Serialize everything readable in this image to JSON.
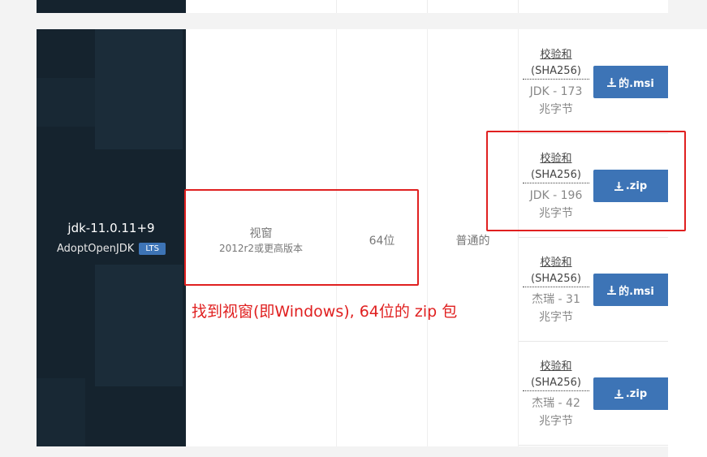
{
  "release": {
    "name": "jdk-11.0.11+9",
    "vendor": "AdoptOpenJDK",
    "badge": "LTS"
  },
  "platform": {
    "os": "视窗",
    "os_version": "2012r2或更高版本",
    "architecture": "64位",
    "jvm_type": "普通的"
  },
  "downloads": [
    {
      "checksum_line1": "校验和",
      "checksum_line2": "(SHA256)",
      "size_line1": "JDK - 173",
      "size_line2": "兆字节",
      "button_label": "的.msi",
      "icon": "download-icon"
    },
    {
      "checksum_line1": "校验和",
      "checksum_line2": "(SHA256)",
      "size_line1": "JDK - 196",
      "size_line2": "兆字节",
      "button_label": ".zip",
      "icon": "download-icon"
    },
    {
      "checksum_line1": "校验和",
      "checksum_line2": "(SHA256)",
      "size_line1": "杰瑞 - 31",
      "size_line2": "兆字节",
      "button_label": "的.msi",
      "icon": "download-icon"
    },
    {
      "checksum_line1": "校验和",
      "checksum_line2": "(SHA256)",
      "size_line1": "杰瑞 - 42",
      "size_line2": "兆字节",
      "button_label": ".zip",
      "icon": "download-icon"
    }
  ],
  "annotation": {
    "text": "找到视窗(即Windows), 64位的 zip 包",
    "color": "#e02020"
  },
  "colors": {
    "panel_dark": "#15232e",
    "button_blue": "#3d74b6",
    "highlight_red": "#e02020"
  }
}
